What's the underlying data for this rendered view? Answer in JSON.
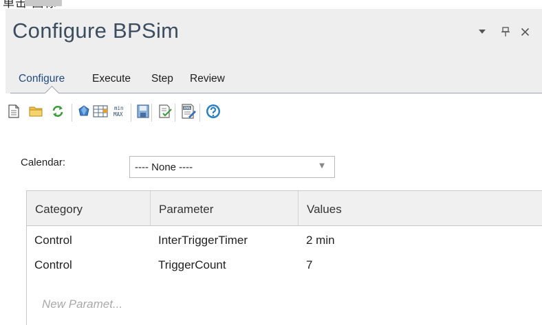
{
  "top_fragment": {
    "text": "单击 图标"
  },
  "panel": {
    "title": "Configure BPSim",
    "controls": {
      "dropdown": "▾",
      "pin": "ф",
      "close": "✕"
    }
  },
  "tabs": [
    {
      "label": "Configure",
      "active": true
    },
    {
      "label": "Execute",
      "active": false
    },
    {
      "label": "Step",
      "active": false
    },
    {
      "label": "Review",
      "active": false
    }
  ],
  "toolbar": {
    "buttons": [
      "new-document-icon",
      "open-folder-icon",
      "refresh-icon",
      "shape-icon",
      "table-icon",
      "min-max-icon",
      "save-icon",
      "validate-icon",
      "xml-export-icon",
      "help-icon"
    ],
    "min_max_text": [
      "min",
      "MAX"
    ],
    "xml_text": "XML"
  },
  "calendar": {
    "label": "Calendar:",
    "selected": "---- None ----"
  },
  "grid": {
    "columns": [
      "Category",
      "Parameter",
      "Values"
    ],
    "rows": [
      {
        "category": "Control",
        "parameter": "InterTriggerTimer",
        "values": "2 min"
      },
      {
        "category": "Control",
        "parameter": "TriggerCount",
        "values": "7"
      }
    ],
    "new_row_placeholder": "New Paramet..."
  },
  "colors": {
    "title_text": "#3b4d5f",
    "active_tab": "#214a80",
    "panel_bg": "#eeeeef",
    "help_blue": "#2a7fc0"
  }
}
